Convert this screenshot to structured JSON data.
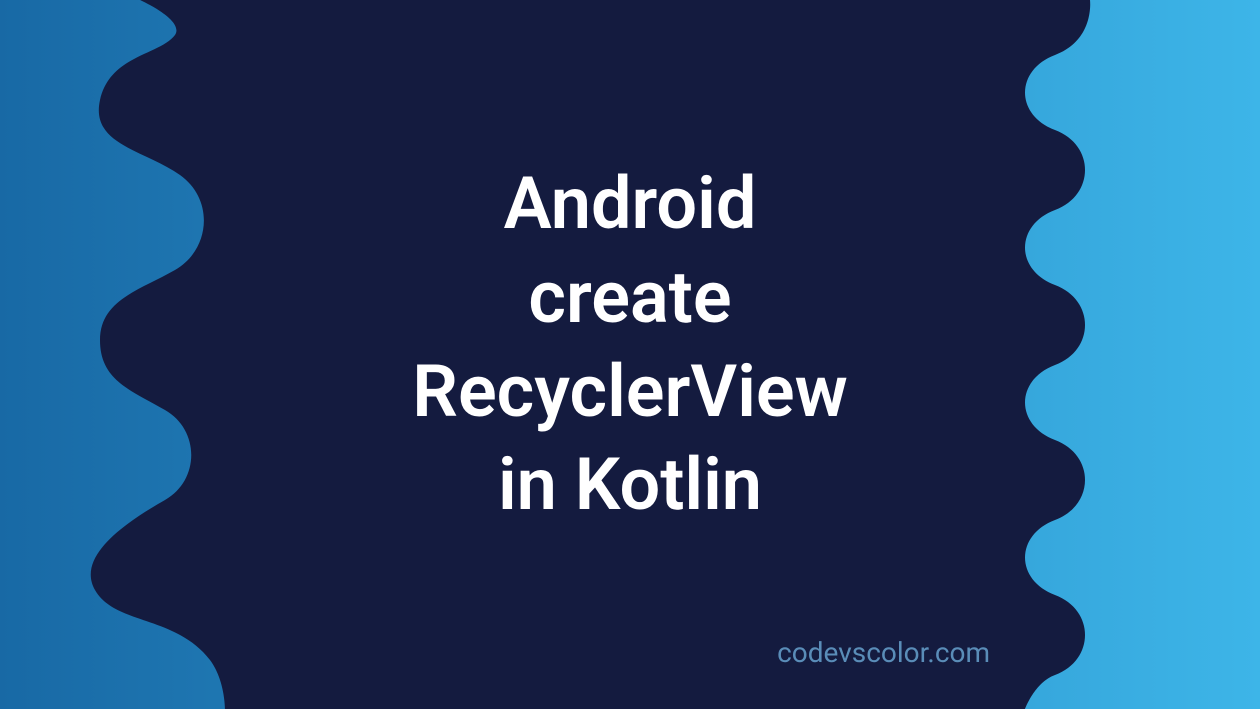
{
  "title": {
    "line1": "Android",
    "line2": "create",
    "line3": "RecyclerView",
    "line4": "in Kotlin"
  },
  "footer": "codevscolor.com",
  "colors": {
    "gradient_start": "#1869a5",
    "gradient_mid": "#2a8fc8",
    "gradient_end": "#3db5e8",
    "blob": "#141b3f",
    "text": "#ffffff",
    "footer_text": "#5a8db8"
  }
}
